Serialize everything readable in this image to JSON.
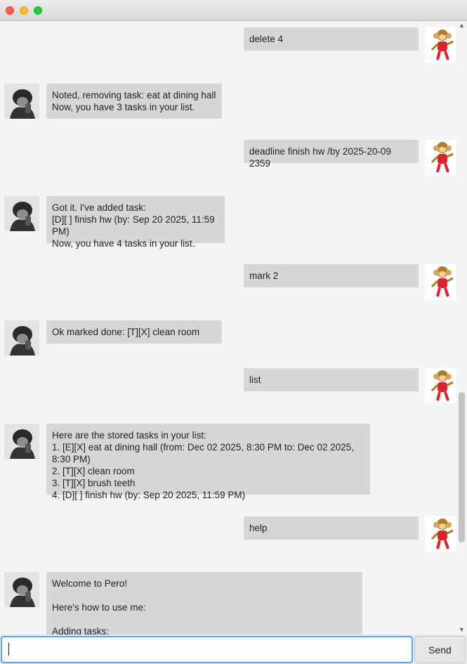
{
  "window": {
    "title": ""
  },
  "messages": [
    {
      "sender": "user",
      "text": "delete 4"
    },
    {
      "sender": "bot",
      "text": "Noted, removing task: eat at dining hall\nNow, you have 3 tasks in your list."
    },
    {
      "sender": "user",
      "text": "deadline finish hw /by 2025-20-09 2359"
    },
    {
      "sender": "bot",
      "text": "Got it. I've added task:\n[D][ ] finish hw (by: Sep 20 2025, 11:59 PM)\nNow, you have 4 tasks in your list."
    },
    {
      "sender": "user",
      "text": "mark 2"
    },
    {
      "sender": "bot",
      "text": "Ok marked done: [T][X] clean room"
    },
    {
      "sender": "user",
      "text": "list"
    },
    {
      "sender": "bot",
      "text": "Here are the stored tasks in your list:\n1. [E][X] eat at dining hall (from: Dec 02 2025, 8:30 PM to: Dec 02 2025, 8:30 PM)\n2. [T][X] clean room\n3. [T][X] brush teeth\n4. [D][ ] finish hw (by: Sep 20 2025, 11:59 PM)"
    },
    {
      "sender": "user",
      "text": "help"
    },
    {
      "sender": "bot",
      "text": "Welcome to Pero!\n\nHere's how to use me:\n\nAdding tasks:"
    }
  ],
  "input": {
    "value": "",
    "placeholder": ""
  },
  "send_label": "Send",
  "icons": {
    "user_avatar": "monkey-avatar-icon",
    "bot_avatar": "chimpanzee-avatar-icon"
  }
}
